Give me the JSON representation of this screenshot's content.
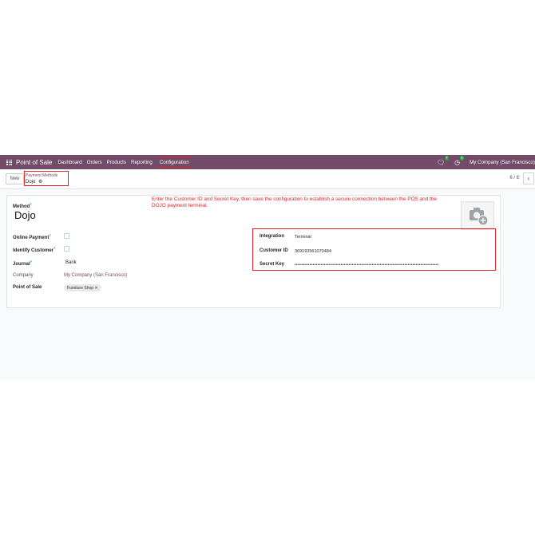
{
  "navbar": {
    "app_title": "Point of Sale",
    "menu": [
      "Dashboard",
      "Orders",
      "Products",
      "Reporting",
      "Configuration"
    ],
    "chat_badge": "7",
    "activity_badge": "4",
    "company": "My Company (San Francisco)"
  },
  "controlbar": {
    "new_label": "New",
    "breadcrumb_parent": "Payment Methods",
    "breadcrumb_current": "Dojo",
    "pager": "6 / 6"
  },
  "instruction": "Enter the Customer ID and Secret Key, then save the configuration to establish a secure connection between the POS and the DOJO payment terminal.",
  "form": {
    "method_label": "Method",
    "method_value": "Dojo",
    "online_payment_label": "Online Payment",
    "identify_customer_label": "Identify Customer",
    "journal_label": "Journal",
    "journal_value": "Bank",
    "company_label": "Company",
    "company_value": "My Company (San Francisco)",
    "pos_label": "Point of Sale",
    "pos_tag": "Furniture Shop",
    "integration_label": "Integration",
    "integration_value": "Terminal",
    "customer_id_label": "Customer ID",
    "customer_id_value": "369193561070484",
    "secret_key_label": "Secret Key",
    "secret_key_value": "••••••••••••••••••••••••••••••••••••••••••••••••••••••••••••••••••••••••••••••••••••••••"
  },
  "colors": {
    "brand": "#714b67",
    "highlight": "#e02424"
  }
}
